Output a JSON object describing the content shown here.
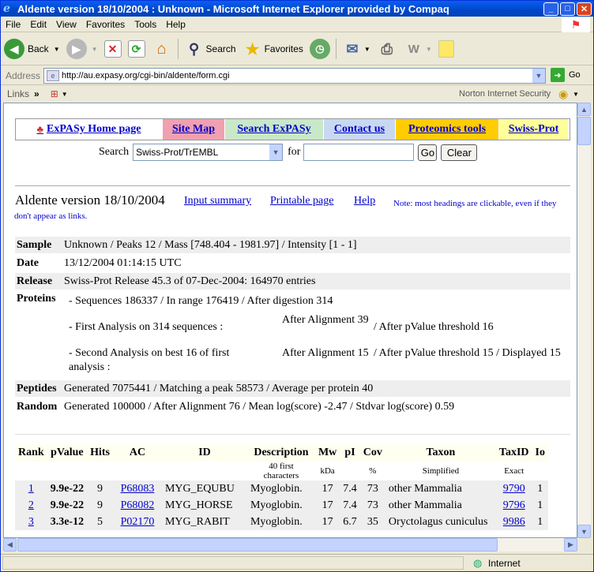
{
  "window": {
    "title": "Aldente version 18/10/2004 : Unknown - Microsoft Internet Explorer provided by Compaq",
    "accent": "#0a5ff2"
  },
  "menu": [
    "File",
    "Edit",
    "View",
    "Favorites",
    "Tools",
    "Help"
  ],
  "toolbar": {
    "back": "Back",
    "search": "Search",
    "favorites": "Favorites"
  },
  "address": {
    "label": "Address",
    "url": "http://au.expasy.org/cgi-bin/aldente/form.cgi",
    "go": "Go"
  },
  "links": {
    "label": "Links",
    "chevron": "»",
    "norton": "Norton Internet Security"
  },
  "nav": [
    {
      "label": "ExPASy Home page",
      "bg": "#ffffff"
    },
    {
      "label": "Site Map",
      "bg": "#f0a0b0"
    },
    {
      "label": "Search ExPASy",
      "bg": "#c8e8c8"
    },
    {
      "label": "Contact us",
      "bg": "#c8d8f0"
    },
    {
      "label": "Proteomics tools",
      "bg": "#ffcc00"
    },
    {
      "label": "Swiss-Prot",
      "bg": "#ffff99"
    }
  ],
  "searchform": {
    "label": "Search",
    "db": "Swiss-Prot/TrEMBL",
    "for": "for",
    "go": "Go",
    "clear": "Clear"
  },
  "header": {
    "title": "Aldente version 18/10/2004",
    "input_summary": "Input summary",
    "printable": "Printable page",
    "help": "Help",
    "note": "Note: most headings are clickable, even if they don't appear as links."
  },
  "summary": {
    "sample_k": "Sample",
    "sample_v": "Unknown / Peaks 12 / Mass [748.404 - 1981.97] / Intensity [1 - 1]",
    "date_k": "Date",
    "date_v": "13/12/2004 01:14:15 UTC",
    "release_k": "Release",
    "release_v": "Swiss-Prot Release 45.3 of 07-Dec-2004: 164970 entries",
    "proteins_k": "Proteins",
    "p1": "- Sequences 186337 / In range 176419 / After digestion 314",
    "p2a": "- First Analysis on 314 sequences :",
    "p2b": "After Alignment 39",
    "p2c": "/ After pValue threshold 16",
    "p3a": "- Second Analysis on best 16 of first analysis :",
    "p3b": "After Alignment 15",
    "p3c": "/ After pValue threshold 15 / Displayed 15",
    "peptides_k": "Peptides",
    "peptides_v": "Generated 7075441 / Matching a peak 58573 / Average per protein 40",
    "random_k": "Random",
    "random_v": "Generated 100000 / After Alignment 76 / Mean log(score) -2.47 / Stdvar log(score) 0.59"
  },
  "results": {
    "headers": [
      "Rank",
      "pValue",
      "Hits",
      "AC",
      "ID",
      "Description",
      "Mw",
      "pI",
      "Cov",
      "Taxon",
      "TaxID",
      "Io"
    ],
    "sub": [
      "",
      "",
      "",
      "",
      "",
      "40 first characters",
      "kDa",
      "",
      "%",
      "Simplified",
      "Exact",
      ""
    ],
    "rows": [
      [
        "1",
        "9.9e-22",
        "9",
        "P68083",
        "MYG_EQUBU",
        "Myoglobin.",
        "17",
        "7.4",
        "73",
        "other Mammalia",
        "9790",
        "1"
      ],
      [
        "2",
        "9.9e-22",
        "9",
        "P68082",
        "MYG_HORSE",
        "Myoglobin.",
        "17",
        "7.4",
        "73",
        "other Mammalia",
        "9796",
        "1"
      ],
      [
        "3",
        "3.3e-12",
        "5",
        "P02170",
        "MYG_RABIT",
        "Myoglobin.",
        "17",
        "6.7",
        "35",
        "Oryctolagus cuniculus",
        "9986",
        "1"
      ]
    ]
  },
  "status": {
    "zone": "Internet"
  }
}
